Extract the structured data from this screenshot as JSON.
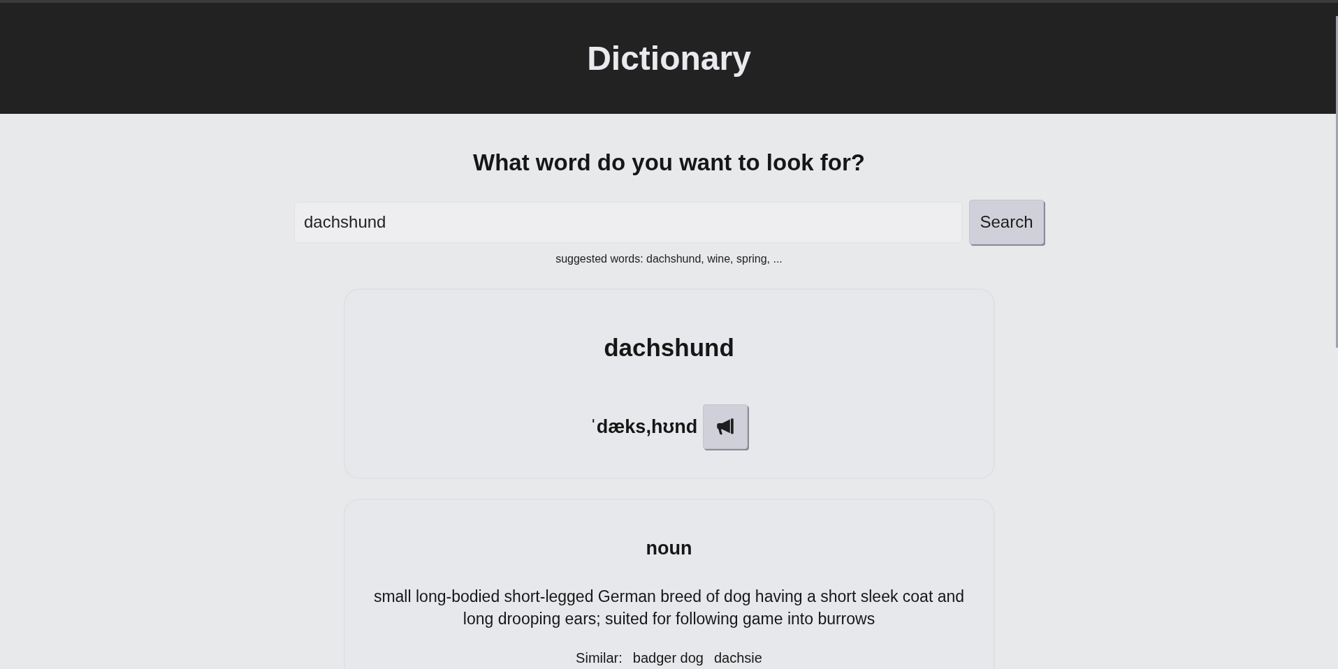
{
  "header": {
    "title": "Dictionary"
  },
  "search": {
    "prompt": "What word do you want to look for?",
    "value": "dachshund",
    "button": "Search",
    "suggestion": "suggested words: dachshund, wine, spring, ..."
  },
  "entry": {
    "word": "dachshund",
    "pronunciation": "ˈdæks,hʊnd"
  },
  "meanings": [
    {
      "part_of_speech": "noun",
      "definition": "small long-bodied short-legged German breed of dog having a short sleek coat and long drooping ears; suited for following game into burrows",
      "similar_label": "Similar:",
      "similar": [
        "badger dog",
        "dachsie"
      ]
    }
  ]
}
